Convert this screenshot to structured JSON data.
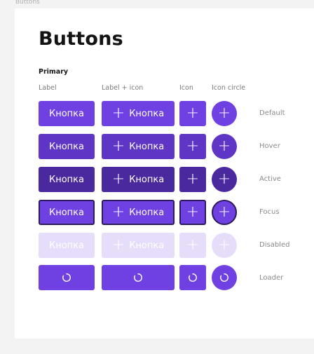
{
  "frame_label": "Buttons",
  "title": "Buttons",
  "section": "Primary",
  "columns": {
    "label": "Label",
    "label_icon": "Label + icon",
    "icon": "Icon",
    "icon_circle": "Icon circle"
  },
  "button_text": "Кнопка",
  "states": [
    "Default",
    "Hover",
    "Active",
    "Focus",
    "Disabled",
    "Loader"
  ],
  "colors": {
    "default": "#6f41e2",
    "hover": "#5e35c4",
    "active": "#4a299e",
    "focus_border": "#2b1a5c",
    "disabled": "#e6ddfa"
  },
  "icons": {
    "add": "plus-icon",
    "loading": "spinner-icon"
  }
}
